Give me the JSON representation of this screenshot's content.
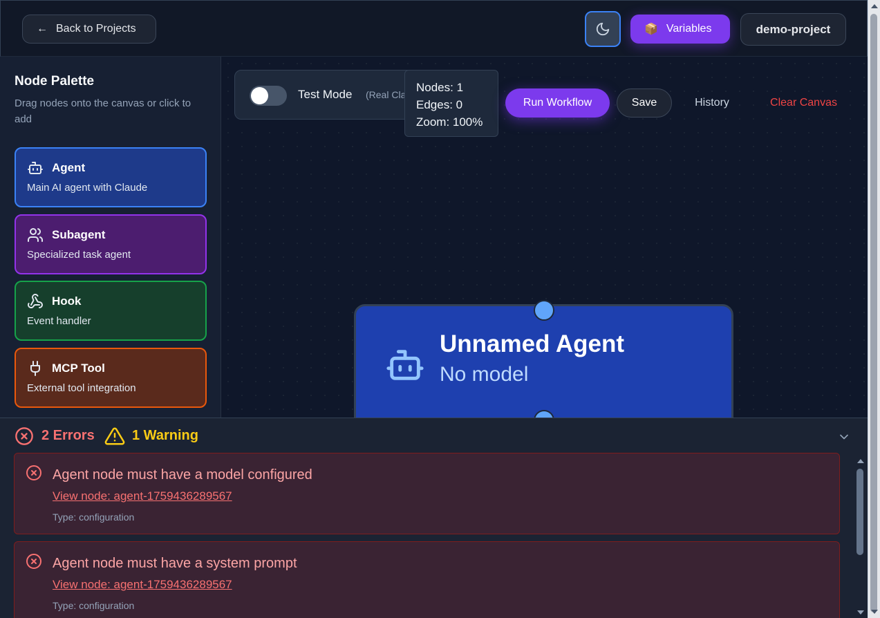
{
  "header": {
    "back_label": "Back to Projects",
    "back_arrow": "←",
    "variables_label": "Variables",
    "variables_emoji": "📦",
    "project_name": "demo-project",
    "theme_icon": "moon-icon"
  },
  "sidebar": {
    "title": "Node Palette",
    "subtitle": "Drag nodes onto the canvas or click to add",
    "items": [
      {
        "name": "Agent",
        "desc": "Main AI agent with Claude",
        "icon": "robot-icon",
        "color": "#3b82f6"
      },
      {
        "name": "Subagent",
        "desc": "Specialized task agent",
        "icon": "users-icon",
        "color": "#9333ea"
      },
      {
        "name": "Hook",
        "desc": "Event handler",
        "icon": "webhook-icon",
        "color": "#16a34a"
      },
      {
        "name": "MCP Tool",
        "desc": "External tool integration",
        "icon": "plug-icon",
        "color": "#ea580c"
      }
    ]
  },
  "toolbar": {
    "test_mode_label": "Test Mode",
    "test_mode_sub": "(Real Cla",
    "test_mode_on": false,
    "run_label": "Run Workflow",
    "save_label": "Save",
    "history_label": "History",
    "clear_label": "Clear Canvas"
  },
  "stats": {
    "nodes": "Nodes: 1",
    "edges": "Edges: 0",
    "zoom": "Zoom: 100%"
  },
  "node": {
    "title": "Unnamed Agent",
    "subtitle": "No model",
    "icon": "robot-icon"
  },
  "errors": {
    "error_count": "2 Errors",
    "warning_count": "1 Warning",
    "items": [
      {
        "message": "Agent node must have a model configured",
        "link": "View node: agent-1759436289567",
        "type": "Type: configuration"
      },
      {
        "message": "Agent node must have a system prompt",
        "link": "View node: agent-1759436289567",
        "type": "Type: configuration"
      }
    ]
  },
  "colors": {
    "accent": "#7c3aed",
    "error": "#f87171",
    "warning": "#facc15",
    "node_bg": "#1e40af"
  }
}
